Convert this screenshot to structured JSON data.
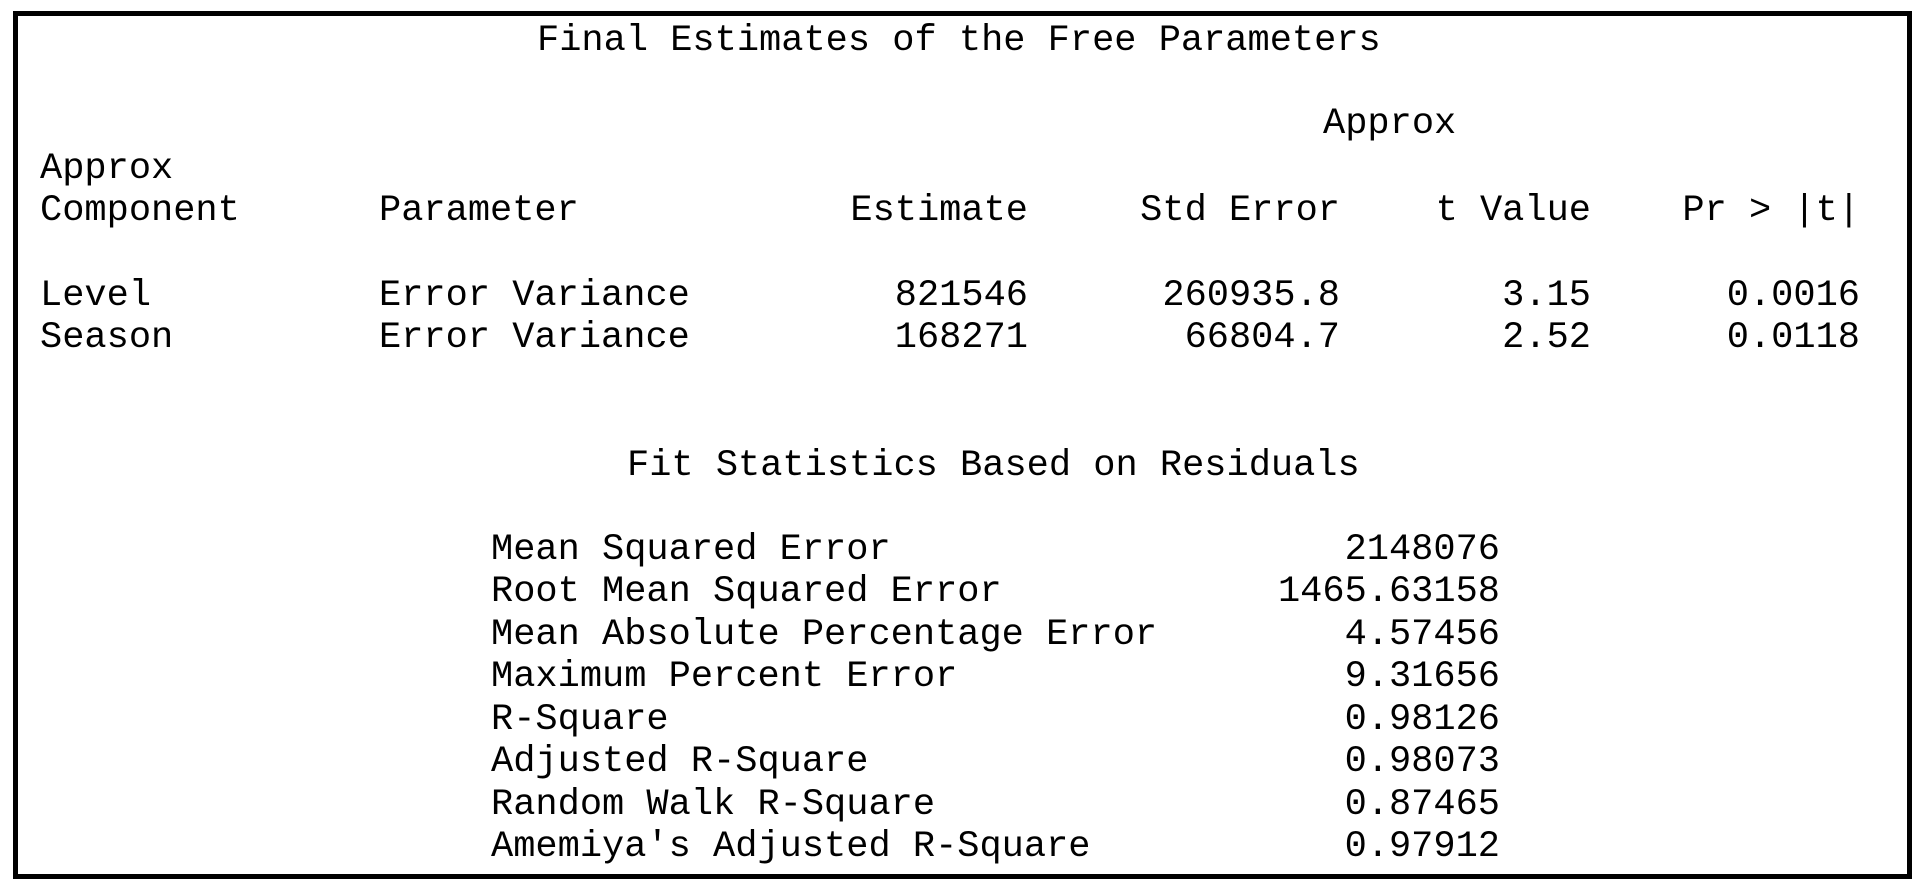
{
  "parameters_table": {
    "title": "Final Estimates of the Free Parameters",
    "spanning_header": "Approx",
    "component_header_top": "Approx",
    "columns": [
      "Component",
      "Parameter",
      "Estimate",
      "Std Error",
      "t Value",
      "Pr > |t|"
    ],
    "rows": [
      {
        "component": "Level",
        "parameter": "Error Variance",
        "estimate": "821546",
        "std_error": "260935.8",
        "t_value": "3.15",
        "p_value": "0.0016"
      },
      {
        "component": "Season",
        "parameter": "Error Variance",
        "estimate": "168271",
        "std_error": "66804.7",
        "t_value": "2.52",
        "p_value": "0.0118"
      }
    ]
  },
  "fit_statistics": {
    "title": "Fit Statistics Based on Residuals",
    "rows": [
      {
        "label": "Mean Squared Error",
        "value": "2148076"
      },
      {
        "label": "Root Mean Squared Error",
        "value": "1465.63158"
      },
      {
        "label": "Mean Absolute Percentage Error",
        "value": "4.57456"
      },
      {
        "label": "Maximum Percent Error",
        "value": "9.31656"
      },
      {
        "label": "R-Square",
        "value": "0.98126"
      },
      {
        "label": "Adjusted R-Square",
        "value": "0.98073"
      },
      {
        "label": "Random Walk R-Square",
        "value": "0.87465"
      },
      {
        "label": "Amemiya's Adjusted R-Square",
        "value": "0.97912"
      }
    ]
  }
}
